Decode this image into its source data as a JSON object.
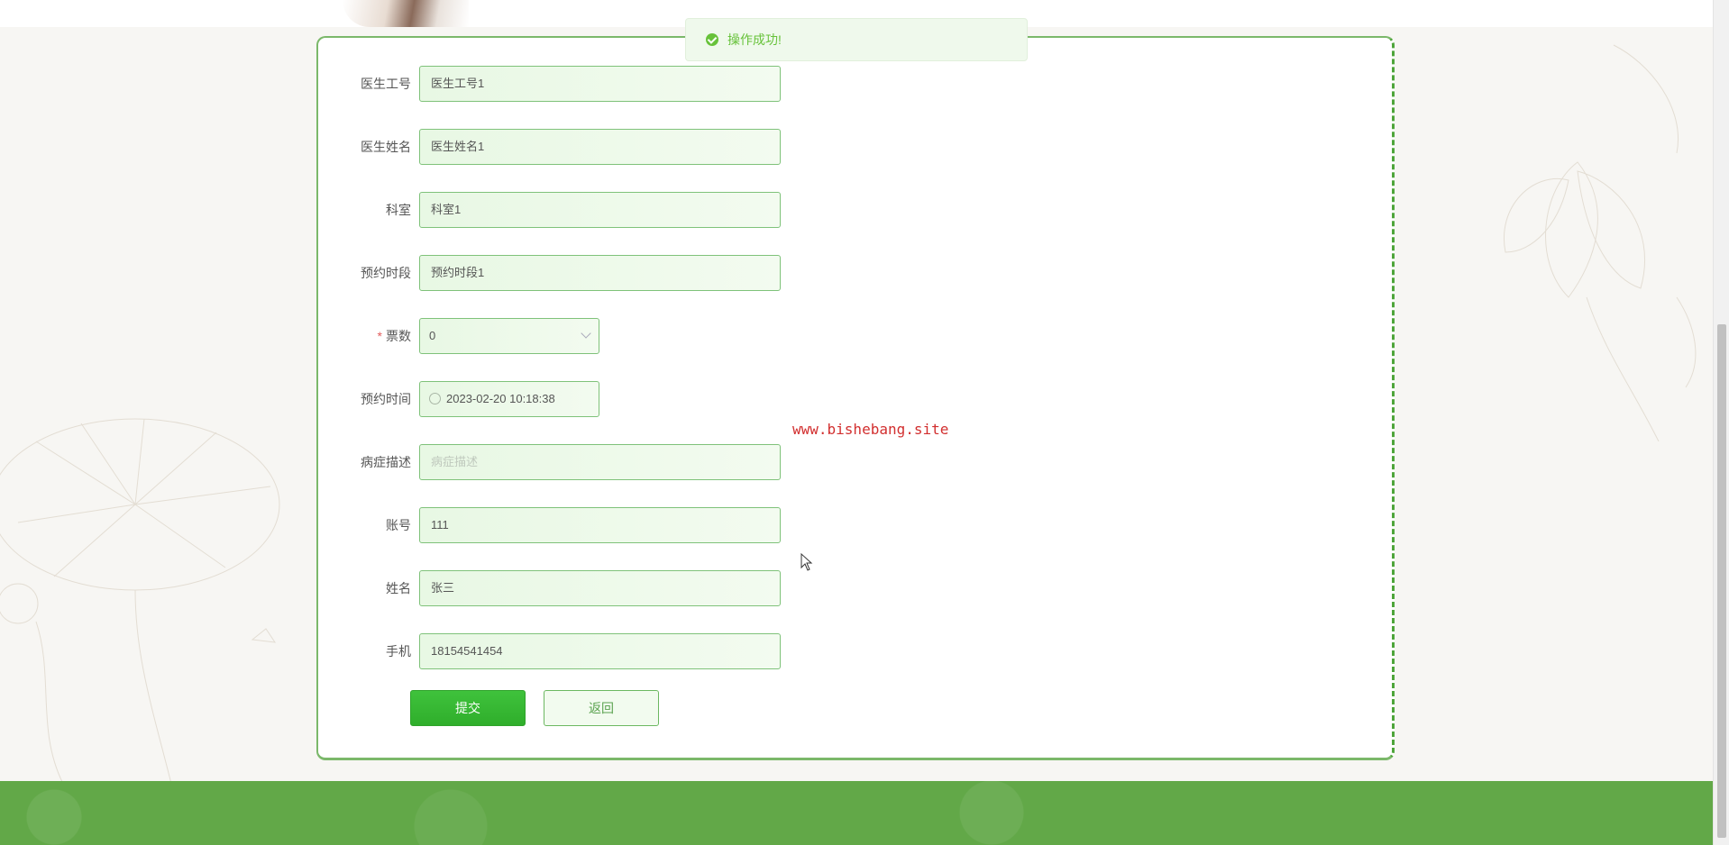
{
  "toast": {
    "message": "操作成功!"
  },
  "form": {
    "fields": [
      {
        "label": "医生工号",
        "value": "医生工号1"
      },
      {
        "label": "医生姓名",
        "value": "医生姓名1"
      },
      {
        "label": "科室",
        "value": "科室1"
      },
      {
        "label": "预约时段",
        "value": "预约时段1"
      },
      {
        "label": "票数",
        "value": "0",
        "required": true
      },
      {
        "label": "预约时间",
        "value": "2023-02-20 10:18:38"
      },
      {
        "label": "病症描述",
        "placeholder": "病症描述"
      },
      {
        "label": "账号",
        "value": "111"
      },
      {
        "label": "姓名",
        "value": "张三"
      },
      {
        "label": "手机",
        "value": "18154541454"
      }
    ],
    "submit_label": "提交",
    "back_label": "返回"
  },
  "watermark": "www.bishebang.site",
  "colors": {
    "accent": "#62a848",
    "success": "#67c23a",
    "required": "#e25c5c"
  }
}
